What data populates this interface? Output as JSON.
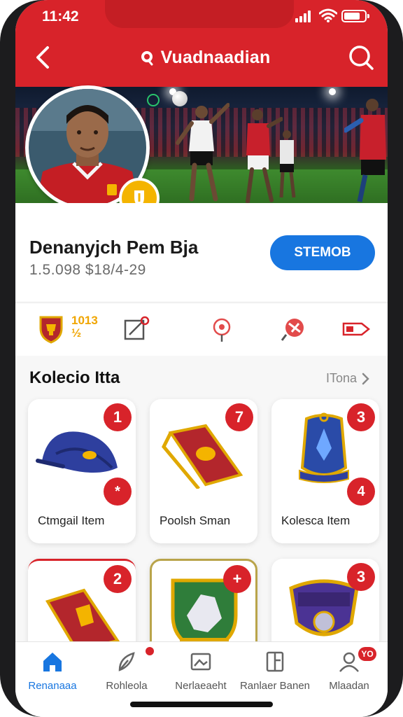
{
  "status_bar": {
    "time": "11:42"
  },
  "header": {
    "title": "Vuadnaadian",
    "back_icon": "chevron-left-icon",
    "search_icon": "search-icon"
  },
  "profile": {
    "name": "Denanyjch Pem Bja",
    "subtitle": "1.5.098 $18/4-29",
    "follow_label": "STEMOB"
  },
  "stats": {
    "first_value": "1013 ½",
    "icons": [
      "trophy-shield-icon",
      "edit-frame-icon",
      "location-pin-icon",
      "whistle-icon",
      "ticket-icon"
    ]
  },
  "collection": {
    "title": "Kolecio Itta",
    "see_all": "ITona",
    "items": [
      {
        "label": "Ctmgail Item",
        "top_badge": "1",
        "mid_badge": "*",
        "art": "blue-cap"
      },
      {
        "label": "Poolsh Sman",
        "top_badge": "7",
        "mid_badge": "+",
        "art": "red-scarf"
      },
      {
        "label": "Kolesca Item",
        "top_badge": "3",
        "mid_badge": "4",
        "art": "blue-trophy-bag"
      },
      {
        "label": "",
        "top_badge": "2",
        "mid_badge": "",
        "art": "red-flag-chair"
      },
      {
        "label": "",
        "top_badge": "+",
        "mid_badge": "",
        "art": "wolf-crest-shield"
      },
      {
        "label": "",
        "top_badge": "3",
        "mid_badge": "",
        "art": "purple-crest-shield"
      }
    ]
  },
  "bottom_nav": {
    "items": [
      {
        "label": "Renanaaa",
        "icon": "home-icon",
        "active": true
      },
      {
        "label": "Rohleola",
        "icon": "feather-pen-icon",
        "active": false
      },
      {
        "label": "Nerlaeaeht",
        "icon": "image-card-icon",
        "active": false
      },
      {
        "label": "Ranlaer Banen",
        "icon": "document-icon",
        "active": false
      },
      {
        "label": "Mlaadan",
        "icon": "profile-icon",
        "active": false
      }
    ],
    "profile_badge": "YO"
  },
  "colors": {
    "brand_red": "#d8232a",
    "accent_blue": "#1876e0",
    "gold": "#f4b400"
  }
}
